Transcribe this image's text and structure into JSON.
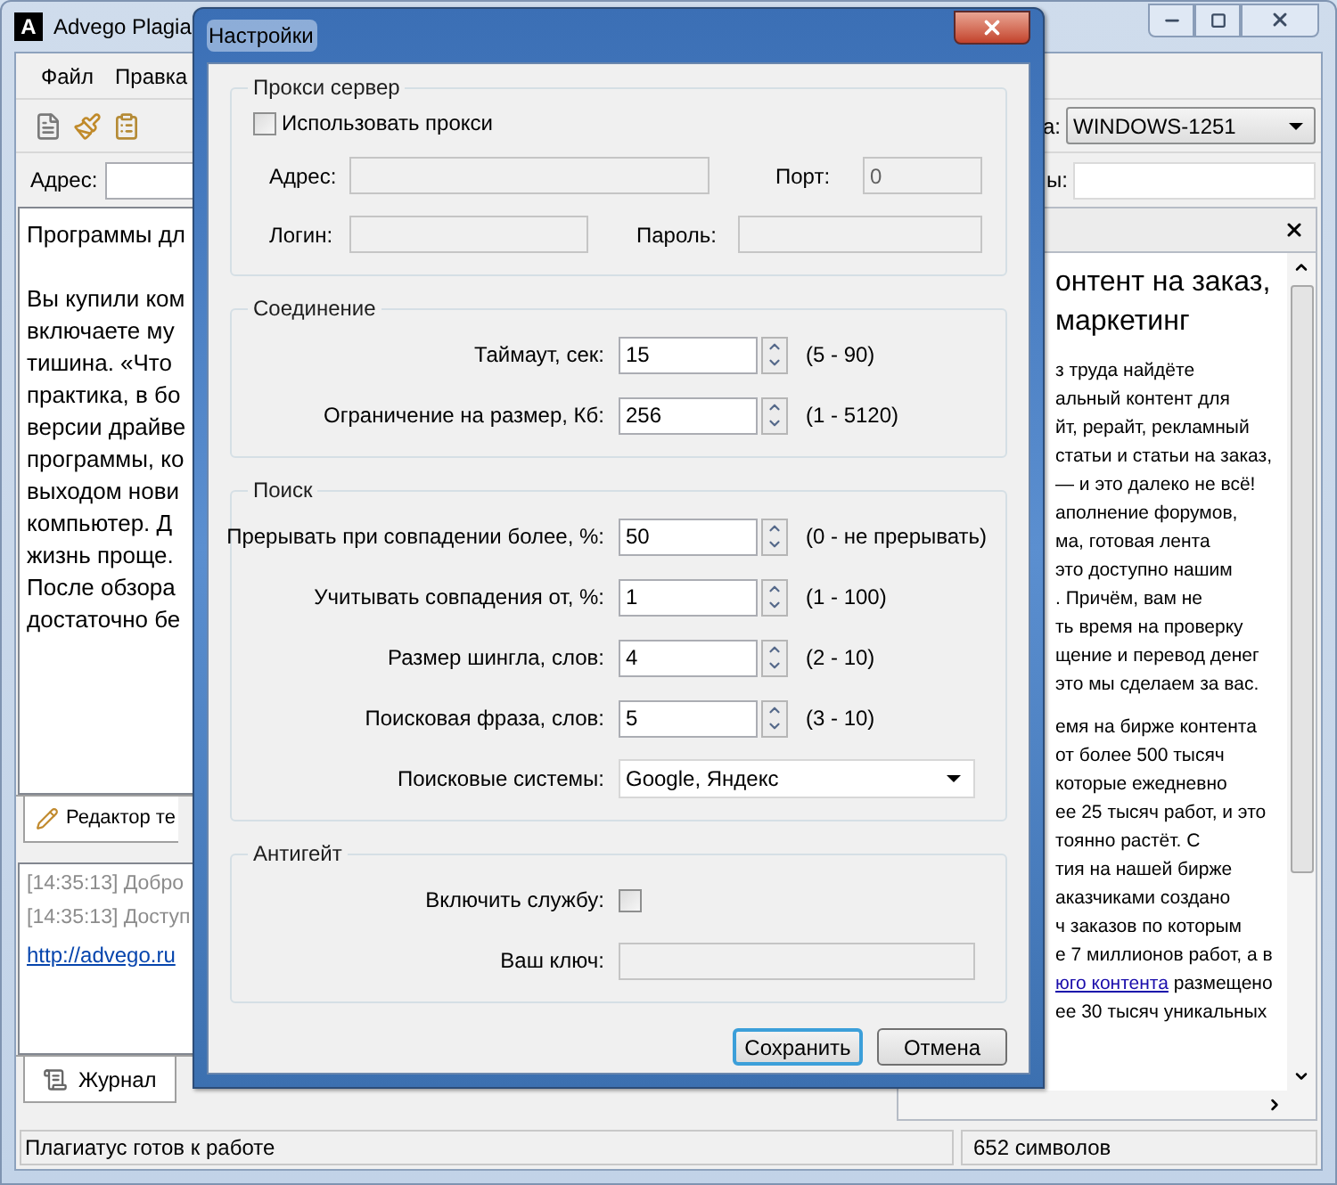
{
  "main_window": {
    "icon_letter": "A",
    "title": "Advego Plagia",
    "menu": [
      "Файл",
      "Правка"
    ],
    "encoding_label": "а:",
    "encoding": "WINDOWS-1251",
    "address_label": "Адрес:",
    "right_field_label": "ы:",
    "editor_paragraphs": [
      [
        "Программы дл"
      ],
      [
        "Вы купили ком",
        "включаете му",
        "тишина. «Что",
        "практика, в бо",
        "версии драйве",
        "программы, ко",
        "выходом нови",
        "компьютер. Д",
        "жизнь проще.",
        "После обзора",
        "достаточно бе"
      ]
    ],
    "editor_tab": "Редактор те",
    "log": [
      {
        "kind": "log",
        "text": "[14:35:13] Добро"
      },
      {
        "kind": "log",
        "text": "[14:35:13] Доступ"
      },
      {
        "kind": "link",
        "text": "http://advego.ru"
      }
    ],
    "log_tab": "Журнал",
    "news": {
      "heading": [
        "онтент на заказ,",
        "маркетинг"
      ],
      "paragraphs": [
        [
          {
            "text": "з труда найдёте"
          },
          {
            "text": "альный контент для"
          },
          {
            "text": "йт, рерайт, рекламный"
          },
          {
            "text": "статьи и статьи на заказ,"
          },
          {
            "text": "— и это далеко не всё!"
          },
          {
            "text": "аполнение форумов,"
          },
          {
            "text": "ма, готовая лента"
          },
          {
            "text": "это доступно нашим"
          },
          {
            "text": ". Причём, вам не"
          },
          {
            "text": "ть время на проверку"
          },
          {
            "text": "щение и перевод денег"
          },
          {
            "text": "это мы сделаем за вас."
          }
        ],
        [
          {
            "text": "емя на бирже контента"
          },
          {
            "text": "от более 500 тысяч"
          },
          {
            "text": "которые ежедневно"
          },
          {
            "text": "ее 25 тысяч работ, и это"
          },
          {
            "text": "тоянно растёт. С"
          },
          {
            "text": "тия на нашей бирже"
          },
          {
            "text": "аказчиками создано"
          },
          {
            "text": "ч заказов по которым"
          },
          {
            "text": "е 7 миллионов работ, а в"
          },
          {
            "link": "юго контента",
            "text": " размещено"
          },
          {
            "text": "ее 30 тысяч уникальных"
          }
        ]
      ]
    },
    "status": "Плагиатус готов к работе",
    "char_count": "652 символов"
  },
  "dialog": {
    "title": "Настройки",
    "groups": [
      {
        "kind": "proxy",
        "title": "Прокси сервер",
        "use_proxy": {
          "label": "Использовать прокси",
          "checked": false
        },
        "fields": [
          {
            "label": "Адрес:",
            "disabled": true
          },
          {
            "label": "Порт:",
            "value": "0",
            "disabled": true
          },
          {
            "label": "Логин:",
            "disabled": true
          },
          {
            "label": "Пароль:",
            "disabled": true
          }
        ]
      },
      {
        "kind": "form",
        "title": "Соединение",
        "rows": [
          {
            "kind": "spin",
            "label": "Таймаут, сек:",
            "value": "15",
            "range": "(5 - 90)"
          },
          {
            "kind": "spin",
            "label": "Ограничение на размер, Кб:",
            "value": "256",
            "range": "(1 - 5120)"
          }
        ]
      },
      {
        "kind": "form",
        "title": "Поиск",
        "rows": [
          {
            "kind": "spin",
            "label": "Прерывать при совпадении более, %:",
            "value": "50",
            "range": "(0 - не прерывать)"
          },
          {
            "kind": "spin",
            "label": "Учитывать совпадения от, %:",
            "value": "1",
            "range": "(1 - 100)"
          },
          {
            "kind": "spin",
            "label": "Размер шингла, слов:",
            "value": "4",
            "range": "(2 - 10)"
          },
          {
            "kind": "spin",
            "label": "Поисковая фраза, слов:",
            "value": "5",
            "range": "(3 - 10)"
          },
          {
            "kind": "select",
            "label": "Поисковые системы:",
            "value": "Google, Яндекс"
          }
        ]
      },
      {
        "kind": "form",
        "title": "Антигейт",
        "rows": [
          {
            "kind": "checkbox",
            "label": "Включить службу:",
            "checked": false
          },
          {
            "kind": "field",
            "label": "Ваш ключ:",
            "disabled": true
          }
        ]
      }
    ],
    "buttons": [
      {
        "label": "Сохранить",
        "default": true
      },
      {
        "label": "Отмена",
        "default": false
      }
    ]
  }
}
